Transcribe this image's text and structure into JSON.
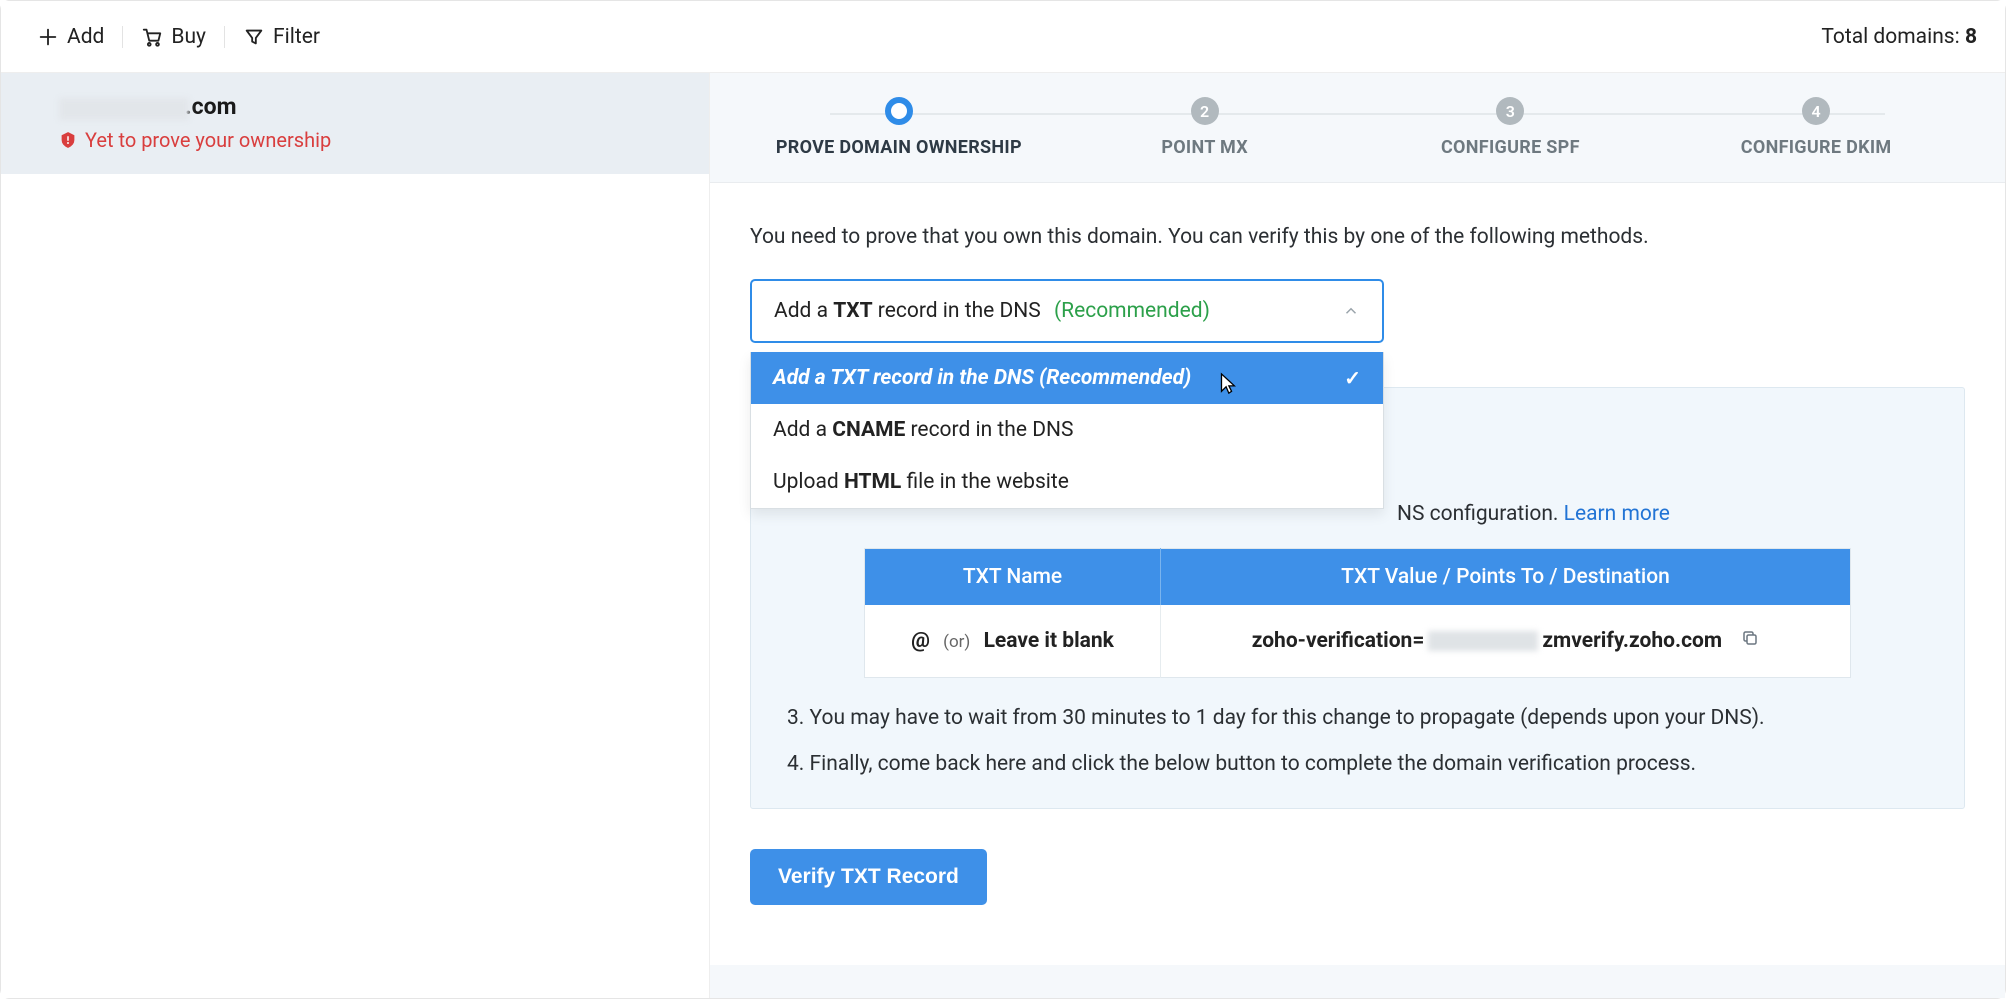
{
  "toolbar": {
    "add_label": "Add",
    "buy_label": "Buy",
    "filter_label": "Filter",
    "total_label": "Total domains: ",
    "total_count": "8"
  },
  "sidebar": {
    "domain_suffix": ".com",
    "status_text": "Yet to prove your ownership"
  },
  "steps": [
    {
      "num": "",
      "label": "PROVE DOMAIN OWNERSHIP",
      "active": true
    },
    {
      "num": "2",
      "label": "POINT MX",
      "active": false
    },
    {
      "num": "3",
      "label": "CONFIGURE SPF",
      "active": false
    },
    {
      "num": "4",
      "label": "CONFIGURE DKIM",
      "active": false
    }
  ],
  "intro_text": "You need to prove that you own this domain. You can verify this by one of the following methods.",
  "dropdown": {
    "selected_prefix": "Add a ",
    "selected_bold": "TXT",
    "selected_suffix": " record in the DNS",
    "recommended": "(Recommended)",
    "options": [
      {
        "html_prefix": "Add a ",
        "html_bold": "TXT",
        "html_suffix": " record in the DNS (Recommended)",
        "selected": true
      },
      {
        "html_prefix": "Add a ",
        "html_bold": "CNAME",
        "html_suffix": " record in the DNS",
        "selected": false
      },
      {
        "html_prefix": "Upload ",
        "html_bold": "HTML",
        "html_suffix": " file in the website",
        "selected": false
      }
    ]
  },
  "info": {
    "line2_partial": "NS configuration. ",
    "learn_more": "Learn more",
    "line3": "3. You may have to wait from 30 minutes to 1 day for this change to propagate (depends upon your DNS).",
    "line4": "4. Finally, come back here and click the below button to complete the domain verification process."
  },
  "table": {
    "header_name": "TXT Name",
    "header_value": "TXT Value / Points To / Destination",
    "name_at": "@",
    "name_or": "(or)",
    "name_blank": "Leave it blank",
    "value_prefix": "zoho-verification=",
    "value_suffix": "zmverify.zoho.com"
  },
  "verify_button": "Verify TXT Record"
}
